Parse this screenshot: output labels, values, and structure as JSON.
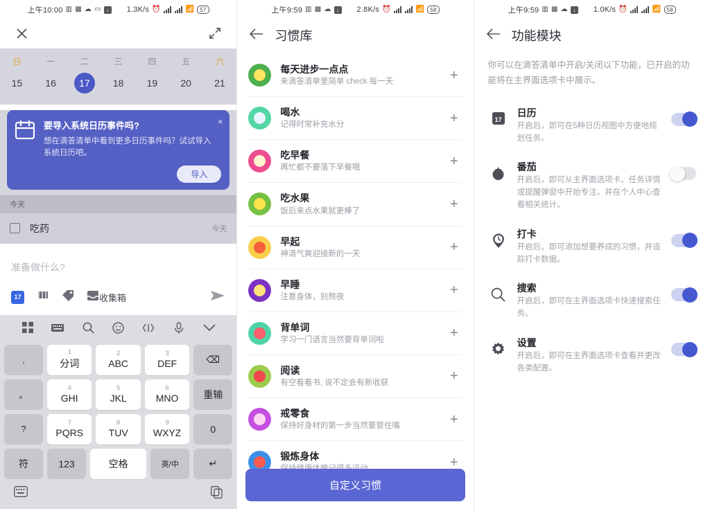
{
  "panel1": {
    "status": {
      "time": "上午10:00",
      "speed": "1.3K/s",
      "battery": "57"
    },
    "topbar": {
      "close_icon": "close-icon",
      "expand_icon": "expand-icon"
    },
    "calendar": {
      "weekdays": [
        "日",
        "一",
        "二",
        "三",
        "四",
        "五",
        "六"
      ],
      "days": [
        "15",
        "16",
        "17",
        "18",
        "19",
        "20",
        "21"
      ],
      "selected_index": 2
    },
    "banner": {
      "title": "要导入系统日历事件吗?",
      "body": "想在滴答清单中看到更多日历事件吗？试试导入系统日历吧。",
      "button": "导入",
      "close": "×"
    },
    "section_header": "今天",
    "task": {
      "title": "吃药",
      "when": "今天"
    },
    "quickadd": {
      "placeholder": "准备做什么?",
      "list_label": "收集箱",
      "date_icon_label": "17"
    },
    "keyboard": {
      "toolbar_icons": [
        "grid-icon",
        "keyboard-icon",
        "search-icon",
        "emoji-icon",
        "code-icon",
        "mic-icon",
        "chevron-down-icon"
      ],
      "left_column": [
        ",",
        "。",
        "?",
        "!"
      ],
      "keys": [
        {
          "num": "1",
          "letters": "分词"
        },
        {
          "num": "2",
          "letters": "ABC"
        },
        {
          "num": "3",
          "letters": "DEF"
        },
        {
          "num": "4",
          "letters": "GHI"
        },
        {
          "num": "5",
          "letters": "JKL"
        },
        {
          "num": "6",
          "letters": "MNO"
        },
        {
          "num": "7",
          "letters": "PQRS"
        },
        {
          "num": "8",
          "letters": "TUV"
        },
        {
          "num": "9",
          "letters": "WXYZ"
        }
      ],
      "backspace": "⌫",
      "redo": "重输",
      "zero": "0",
      "symbol": "符",
      "num_mode": "123",
      "space": "空格",
      "lang": "英/中",
      "enter": "↵"
    }
  },
  "panel2": {
    "status": {
      "time": "上午9:59",
      "speed": "2.8K/s",
      "battery": "58"
    },
    "title": "习惯库",
    "back_icon": "back-arrow-icon",
    "habits": [
      {
        "name": "每天进步一点点",
        "desc": "来滴答清单里简单 check 每一天",
        "glyph": "☺",
        "bg": "#4caf50",
        "inner": "#fde45f"
      },
      {
        "name": "喝水",
        "desc": "记得时常补充水分",
        "glyph": "🥛",
        "bg": "#52d6a4",
        "inner": "#e8f4ff"
      },
      {
        "name": "吃早餐",
        "desc": "再忙都不要落下早餐哦",
        "glyph": "🍳",
        "bg": "#ed4d91",
        "inner": "#fff3d0"
      },
      {
        "name": "吃水果",
        "desc": "饭后来点水果就更棒了",
        "glyph": "🍌",
        "bg": "#76c043",
        "inner": "#ffe34d"
      },
      {
        "name": "早起",
        "desc": "神清气爽迎接新的一天",
        "glyph": "☀",
        "bg": "#f9cf4a",
        "inner": "#f4623a"
      },
      {
        "name": "早睡",
        "desc": "注意身体，别熬夜",
        "glyph": "🌙",
        "bg": "#7b32c4",
        "inner": "#ffe27a"
      },
      {
        "name": "背单词",
        "desc": "学习一门语言当然要背单词啦",
        "glyph": "❞",
        "bg": "#4ed3a7",
        "inner": "#ff5f6d"
      },
      {
        "name": "阅读",
        "desc": "有空看看书, 说不定会有新收获",
        "glyph": "📕",
        "bg": "#9ccb4c",
        "inner": "#f2484f"
      },
      {
        "name": "戒零食",
        "desc": "保持好身材的第一步当然要管住嘴",
        "glyph": "🍦",
        "bg": "#c44fe0",
        "inner": "#ffd6f2"
      },
      {
        "name": "锻炼身体",
        "desc": "保持健康体魄记得多运动",
        "glyph": "❤",
        "bg": "#3b8fe8",
        "inner": "#ff5a4e"
      }
    ],
    "cta": "自定义习惯"
  },
  "panel3": {
    "status": {
      "time": "上午9:59",
      "speed": "1.0K/s",
      "battery": "58"
    },
    "title": "功能模块",
    "back_icon": "back-arrow-icon",
    "note": "你可以在滴答清单中开启/关闭以下功能，已开启的功能将在主界面选项卡中展示。",
    "modules": [
      {
        "name": "日历",
        "desc": "开启后，即可在5种日历视图中方便地规划任务。",
        "icon": "calendar-icon",
        "enabled": true
      },
      {
        "name": "番茄",
        "desc": "开启后，即可从主界面选项卡、任务详情或提醒弹窗中开始专注，并在个人中心查看相关统计。",
        "icon": "tomato-icon",
        "enabled": false
      },
      {
        "name": "打卡",
        "desc": "开启后，即可添加想要养成的习惯，并追踪打卡数据。",
        "icon": "clock-pin-icon",
        "enabled": true
      },
      {
        "name": "搜索",
        "desc": "开启后，即可在主界面选项卡快速搜索任务。",
        "icon": "search-icon",
        "enabled": true
      },
      {
        "name": "设置",
        "desc": "开启后，即可在主界面选项卡查看并更改各类配置。",
        "icon": "gear-icon",
        "enabled": true
      }
    ]
  },
  "colors": {
    "accent": "#4b59c6",
    "banner": "#5560c4",
    "cta": "#5a66d4",
    "weekend": "#e2a33c"
  }
}
